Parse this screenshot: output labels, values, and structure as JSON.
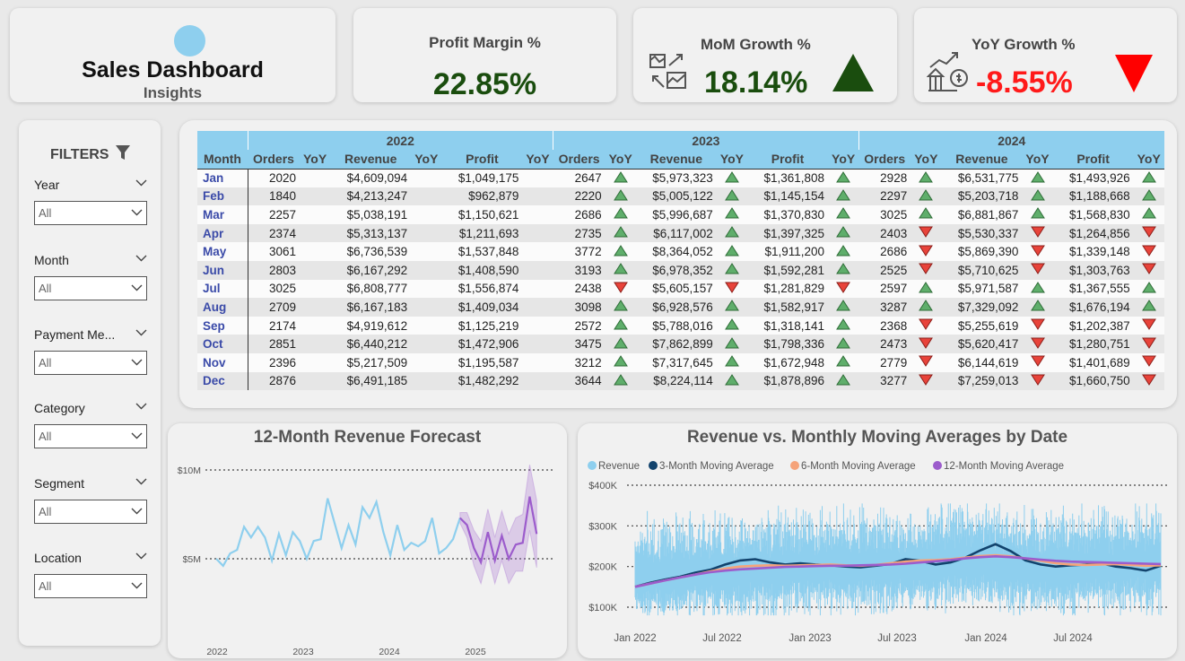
{
  "header": {
    "title": "Sales Dashboard",
    "subtitle": "Insights"
  },
  "kpis": {
    "profit_margin": {
      "label": "Profit Margin %",
      "value": "22.85%"
    },
    "mom_growth": {
      "label": "MoM Growth %",
      "value": "18.14%",
      "trend": "up",
      "icon": "growth-chart-icon"
    },
    "yoy_growth": {
      "label": "YoY Growth %",
      "value": "-8.55%",
      "trend": "down",
      "icon": "bank-growth-icon"
    }
  },
  "colors": {
    "accent": "#8ecfee",
    "positive": "#1a4d0e",
    "negative": "#ff1a1a",
    "up_arrow": "#5fae6b",
    "down_arrow": "#e8433a",
    "revenue": "#8ecfee",
    "ma3": "#12436d",
    "ma6": "#f5a37a",
    "ma12": "#9c5ccc"
  },
  "filters": {
    "title": "FILTERS",
    "items": [
      {
        "label": "Year",
        "value": "All"
      },
      {
        "label": "Month",
        "value": "All"
      },
      {
        "label": "Payment Me...",
        "value": "All"
      },
      {
        "label": "Category",
        "value": "All"
      },
      {
        "label": "Segment",
        "value": "All"
      },
      {
        "label": "Location",
        "value": "All"
      }
    ]
  },
  "table": {
    "years": [
      "2022",
      "2023",
      "2024"
    ],
    "headers": {
      "month": "Month",
      "orders": "Orders",
      "yoy": "YoY",
      "revenue": "Revenue",
      "profit": "Profit"
    },
    "rows": [
      {
        "month": "Jan",
        "y2022": [
          "2020",
          "$4,609,094",
          "$1,049,175"
        ],
        "y2023": [
          "2647",
          "up",
          "$5,973,323",
          "up",
          "$1,361,808",
          "up"
        ],
        "y2024": [
          "2928",
          "up",
          "$6,531,775",
          "up",
          "$1,493,926",
          "up"
        ]
      },
      {
        "month": "Feb",
        "y2022": [
          "1840",
          "$4,213,247",
          "$962,879"
        ],
        "y2023": [
          "2220",
          "up",
          "$5,005,122",
          "up",
          "$1,145,154",
          "up"
        ],
        "y2024": [
          "2297",
          "up",
          "$5,203,718",
          "up",
          "$1,188,668",
          "up"
        ]
      },
      {
        "month": "Mar",
        "y2022": [
          "2257",
          "$5,038,191",
          "$1,150,621"
        ],
        "y2023": [
          "2686",
          "up",
          "$5,996,687",
          "up",
          "$1,370,830",
          "up"
        ],
        "y2024": [
          "3025",
          "up",
          "$6,881,867",
          "up",
          "$1,568,830",
          "up"
        ]
      },
      {
        "month": "Apr",
        "y2022": [
          "2374",
          "$5,313,137",
          "$1,211,693"
        ],
        "y2023": [
          "2735",
          "up",
          "$6,117,002",
          "up",
          "$1,397,325",
          "up"
        ],
        "y2024": [
          "2403",
          "down",
          "$5,530,337",
          "down",
          "$1,264,856",
          "down"
        ]
      },
      {
        "month": "May",
        "y2022": [
          "3061",
          "$6,736,539",
          "$1,537,848"
        ],
        "y2023": [
          "3772",
          "up",
          "$8,364,052",
          "up",
          "$1,911,200",
          "up"
        ],
        "y2024": [
          "2686",
          "down",
          "$5,869,390",
          "down",
          "$1,339,148",
          "down"
        ]
      },
      {
        "month": "Jun",
        "y2022": [
          "2803",
          "$6,167,292",
          "$1,408,590"
        ],
        "y2023": [
          "3193",
          "up",
          "$6,978,352",
          "up",
          "$1,592,281",
          "up"
        ],
        "y2024": [
          "2525",
          "down",
          "$5,710,625",
          "down",
          "$1,303,763",
          "down"
        ]
      },
      {
        "month": "Jul",
        "y2022": [
          "3025",
          "$6,808,777",
          "$1,556,874"
        ],
        "y2023": [
          "2438",
          "down",
          "$5,605,157",
          "down",
          "$1,281,829",
          "down"
        ],
        "y2024": [
          "2597",
          "up",
          "$5,971,587",
          "up",
          "$1,367,555",
          "up"
        ]
      },
      {
        "month": "Aug",
        "y2022": [
          "2709",
          "$6,167,183",
          "$1,409,034"
        ],
        "y2023": [
          "3098",
          "up",
          "$6,928,576",
          "up",
          "$1,582,917",
          "up"
        ],
        "y2024": [
          "3287",
          "up",
          "$7,329,092",
          "up",
          "$1,676,194",
          "up"
        ]
      },
      {
        "month": "Sep",
        "y2022": [
          "2174",
          "$4,919,612",
          "$1,125,219"
        ],
        "y2023": [
          "2572",
          "up",
          "$5,788,016",
          "up",
          "$1,318,141",
          "up"
        ],
        "y2024": [
          "2368",
          "down",
          "$5,255,619",
          "down",
          "$1,202,387",
          "down"
        ]
      },
      {
        "month": "Oct",
        "y2022": [
          "2851",
          "$6,440,212",
          "$1,472,906"
        ],
        "y2023": [
          "3475",
          "up",
          "$7,862,899",
          "up",
          "$1,798,336",
          "up"
        ],
        "y2024": [
          "2473",
          "down",
          "$5,620,417",
          "down",
          "$1,280,751",
          "down"
        ]
      },
      {
        "month": "Nov",
        "y2022": [
          "2396",
          "$5,217,509",
          "$1,195,587"
        ],
        "y2023": [
          "3212",
          "up",
          "$7,317,645",
          "up",
          "$1,672,948",
          "up"
        ],
        "y2024": [
          "2779",
          "down",
          "$6,144,619",
          "down",
          "$1,401,689",
          "down"
        ]
      },
      {
        "month": "Dec",
        "y2022": [
          "2876",
          "$6,491,185",
          "$1,482,292"
        ],
        "y2023": [
          "3644",
          "up",
          "$8,224,114",
          "up",
          "$1,878,896",
          "up"
        ],
        "y2024": [
          "3277",
          "down",
          "$7,259,013",
          "down",
          "$1,660,750",
          "down"
        ]
      }
    ]
  },
  "chart_data": [
    {
      "type": "line",
      "title": "12-Month Revenue Forecast",
      "xlabel": "",
      "ylabel": "",
      "x_ticks": [
        "2022",
        "2023",
        "2024",
        "2025"
      ],
      "y_ticks": [
        "$10M",
        "$5M"
      ],
      "ylim": [
        0,
        10
      ],
      "grid": "dotted horizontal",
      "series": [
        {
          "values": [
            5.0,
            4.6,
            5.3,
            5.5,
            6.8,
            6.2,
            6.8,
            6.2,
            4.9,
            6.4,
            5.2,
            6.5,
            6.0,
            5.0,
            6.0,
            6.1,
            8.4,
            7.0,
            5.6,
            6.9,
            5.8,
            7.9,
            7.3,
            8.2,
            6.5,
            5.2,
            6.9,
            5.5,
            5.9,
            5.7,
            6.0,
            7.3,
            5.3,
            5.6,
            6.1,
            7.3
          ]
        },
        {
          "values": [
            7.3,
            6.9,
            5.6,
            4.8,
            6.5,
            4.9,
            6.3,
            5.0,
            5.8,
            5.9,
            8.5,
            6.4
          ]
        }
      ],
      "forecast_lower": [
        7.0,
        6.2,
        4.6,
        3.6,
        5.2,
        3.6,
        4.9,
        3.6,
        4.3,
        4.3,
        6.6,
        4.5
      ],
      "forecast_upper": [
        7.6,
        7.6,
        6.6,
        6.0,
        7.8,
        6.2,
        7.7,
        6.4,
        7.3,
        7.5,
        10.3,
        8.3
      ]
    },
    {
      "type": "line",
      "title": "Revenue vs. Monthly Moving Averages by Date",
      "xlabel": "",
      "ylabel": "",
      "legend": "top-left",
      "x_ticks": [
        "Jan 2022",
        "Jul 2022",
        "Jan 2023",
        "Jul 2023",
        "Jan 2024",
        "Jul 2024"
      ],
      "y_ticks": [
        "$400K",
        "$300K",
        "$200K",
        "$100K"
      ],
      "ylim": [
        100,
        400
      ],
      "grid": "dotted horizontal",
      "series": [
        {
          "name": "Revenue",
          "values": [
            175,
            180,
            178,
            182,
            186,
            185,
            183,
            187,
            190,
            192,
            195,
            196,
            198,
            199,
            200,
            202,
            200,
            203,
            201,
            204,
            206,
            210,
            215,
            212,
            205,
            200,
            198,
            196,
            197,
            198,
            200,
            202,
            200,
            203,
            205,
            207
          ]
        },
        {
          "name": "3-Month Moving Average",
          "values": [
            150,
            160,
            168,
            175,
            185,
            192,
            205,
            215,
            218,
            210,
            205,
            208,
            205,
            203,
            200,
            198,
            202,
            206,
            218,
            214,
            205,
            210,
            222,
            240,
            255,
            238,
            215,
            205,
            200,
            203,
            205,
            208,
            200,
            196,
            190,
            202
          ]
        },
        {
          "name": "6-Month Moving Average",
          "values": [
            150,
            158,
            166,
            173,
            180,
            188,
            195,
            200,
            202,
            203,
            202,
            203,
            204,
            205,
            203,
            202,
            204,
            208,
            212,
            215,
            216,
            218,
            222,
            226,
            228,
            225,
            220,
            214,
            208,
            205,
            204,
            205,
            206,
            204,
            202,
            203
          ]
        },
        {
          "name": "12-Month Moving Average",
          "values": [
            150,
            158,
            166,
            173,
            180,
            186,
            190,
            193,
            195,
            197,
            199,
            200,
            201,
            202,
            202,
            203,
            204,
            205,
            207,
            210,
            213,
            216,
            220,
            223,
            225,
            223,
            220,
            217,
            214,
            212,
            211,
            210,
            209,
            208,
            207,
            206
          ]
        }
      ]
    }
  ]
}
